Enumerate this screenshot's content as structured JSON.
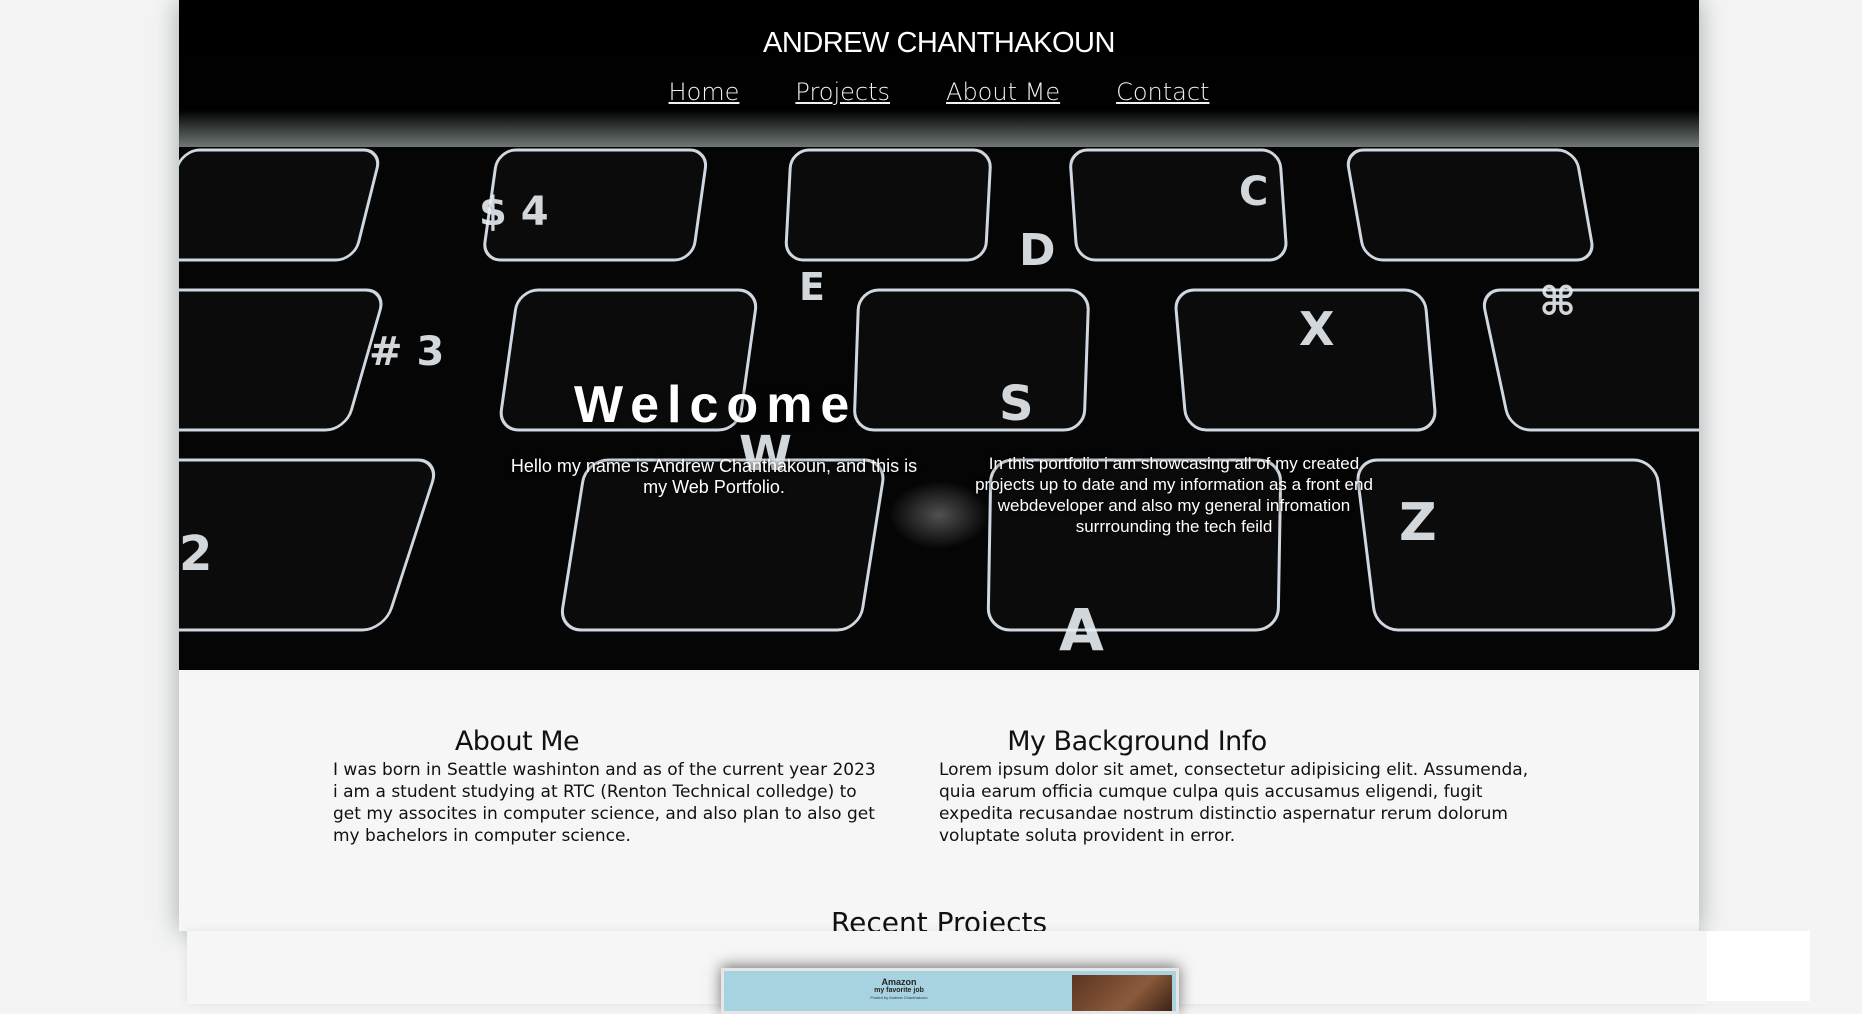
{
  "header": {
    "site_title": "ANDREW CHANTHAKOUN",
    "nav": [
      "Home",
      "Projects",
      "About Me",
      "Contact"
    ]
  },
  "hero": {
    "welcome": "Welcome",
    "intro_left": "Hello my name is Andrew Chanthakoun, and this is my Web Portfolio.",
    "intro_right": "In this portfolio i am showcasing all of my created projects up to date and my information as a front end webdeveloper and also my general infromation surrrounding the tech feild"
  },
  "about": {
    "heading": "About Me",
    "text": "I was born in Seattle washinton and as of the current year 2023 i am a student studying at RTC (Renton Technical colledge) to get my assocites in computer science, and also plan to also get my bachelors in computer science."
  },
  "background": {
    "heading": "My Background Info",
    "text": "Lorem ipsum dolor sit amet, consectetur adipisicing elit. Assumenda, quia earum officia cumque culpa quis accusamus eligendi, fugit expedita recusandae nostrum distinctio aspernatur rerum dolorum voluptate soluta provident in error."
  },
  "recent": {
    "heading": "Recent Projects",
    "card": {
      "title": "Amazon",
      "subtitle": "my favorite job",
      "note": "Posted by Andrew Chanthakoun"
    }
  },
  "colors": {
    "page_bg": "#f6f6f6",
    "hero_bg": "#050505",
    "card_bg": "#a7d3e0"
  }
}
